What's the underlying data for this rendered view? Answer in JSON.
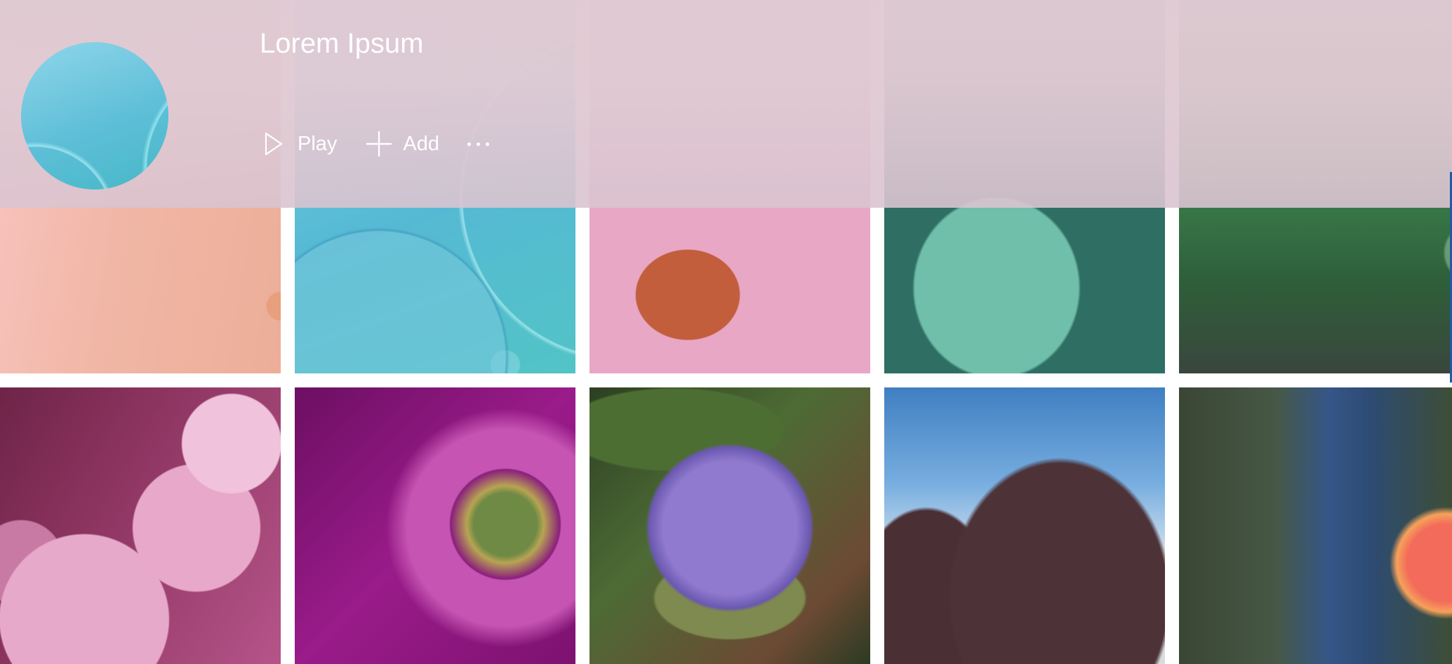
{
  "header": {
    "title": "Lorem Ipsum",
    "play_label": "Play",
    "add_label": "Add",
    "more_label": "More options"
  },
  "icons": {
    "play": "play-icon",
    "add": "add-icon",
    "more": "more-icon"
  },
  "gallery": {
    "rows": [
      {
        "tiles": [
          "peach-bubble",
          "teal-bubble",
          "orange-oil-bubbles",
          "mint-oil-bubbles",
          "green-bubble"
        ]
      },
      {
        "tiles": [
          "pink-flower",
          "magenta-flower",
          "purple-thistle",
          "thistle-sky",
          "red-dahlia"
        ]
      }
    ]
  },
  "colors": {
    "header_bg": "#e0cad3",
    "text": "#ffffff",
    "accent": "#1f5aa8"
  }
}
